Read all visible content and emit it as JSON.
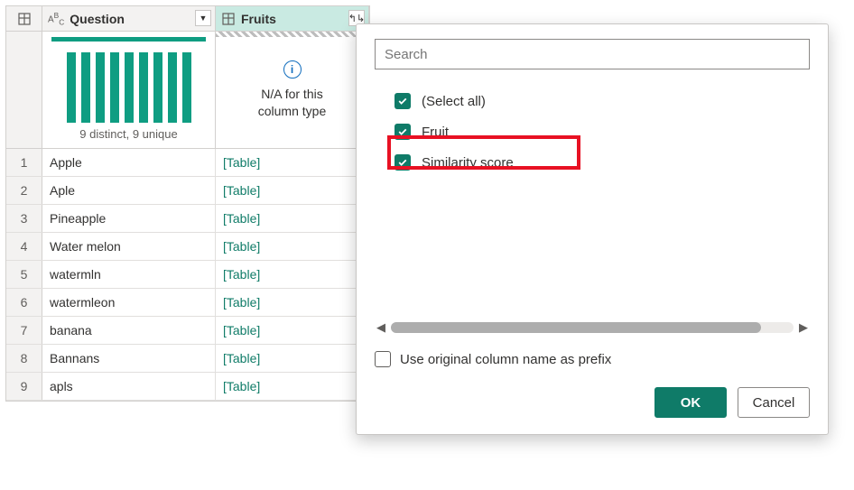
{
  "columns": {
    "question": {
      "label": "Question",
      "type_icon": "ABC"
    },
    "fruits": {
      "label": "Fruits"
    }
  },
  "profile": {
    "question_summary": "9 distinct, 9 unique",
    "fruits_na_line1": "N/A for this",
    "fruits_na_line2": "column type"
  },
  "rows": [
    {
      "n": "1",
      "question": "Apple",
      "fruits": "[Table]"
    },
    {
      "n": "2",
      "question": "Aple",
      "fruits": "[Table]"
    },
    {
      "n": "3",
      "question": "Pineapple",
      "fruits": "[Table]"
    },
    {
      "n": "4",
      "question": "Water melon",
      "fruits": "[Table]"
    },
    {
      "n": "5",
      "question": "watermln",
      "fruits": "[Table]"
    },
    {
      "n": "6",
      "question": "watermleon",
      "fruits": "[Table]"
    },
    {
      "n": "7",
      "question": "banana",
      "fruits": "[Table]"
    },
    {
      "n": "8",
      "question": "Bannans",
      "fruits": "[Table]"
    },
    {
      "n": "9",
      "question": "apls",
      "fruits": "[Table]"
    }
  ],
  "popup": {
    "search_placeholder": "Search",
    "options": [
      {
        "label": "(Select all)",
        "checked": true
      },
      {
        "label": "Fruit",
        "checked": true
      },
      {
        "label": "Similarity score",
        "checked": true
      }
    ],
    "prefix_label": "Use original column name as prefix",
    "prefix_checked": false,
    "ok_label": "OK",
    "cancel_label": "Cancel"
  }
}
